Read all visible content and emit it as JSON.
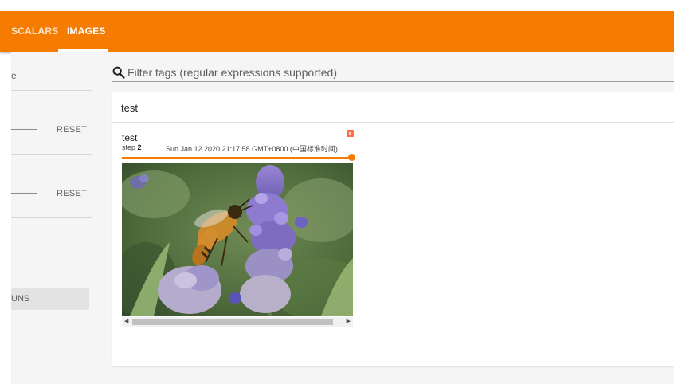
{
  "header": {
    "tabs": [
      {
        "label": "SCALARS",
        "active": false
      },
      {
        "label": "IMAGES",
        "active": true
      }
    ],
    "accent_color": "#f57c00"
  },
  "sidebar": {
    "top_text": "e",
    "reset_label_1": "RESET",
    "reset_label_2": "RESET",
    "runs_button_label": "UNS"
  },
  "filter": {
    "placeholder": "Filter tags (regular expressions supported)",
    "value": "",
    "icon": "search-icon"
  },
  "panel": {
    "title": "test",
    "card": {
      "tag": "test",
      "step_label": "step",
      "step_value": "2",
      "timestamp": "Sun Jan 12 2020 21:17:58 GMT+0800 (中国标准时间)",
      "expand_icon": "fullscreen-icon",
      "slider_position": 1.0,
      "image_subject": "bee on lavender flower"
    }
  }
}
